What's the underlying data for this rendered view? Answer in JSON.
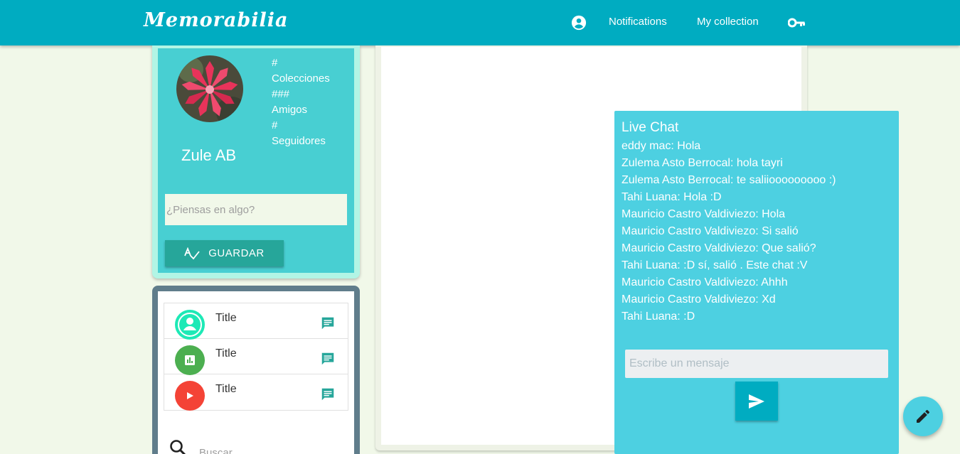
{
  "nav": {
    "brand": "Memorabilia",
    "links": {
      "notifications": "Notifications",
      "collection": "My collection"
    },
    "icons": {
      "account": "account-circle-icon",
      "key": "vpn-key-icon"
    }
  },
  "profile": {
    "name": "Zule AB",
    "stats": {
      "collections_count": "#",
      "collections_label": "Colecciones",
      "friends_count": "###",
      "friends_label": "Amigos",
      "followers_count": "#",
      "followers_label": "Seguidores"
    },
    "thought_placeholder": "¿Piensas en algo?",
    "save_label": "GUARDAR"
  },
  "list": {
    "items": [
      {
        "title": "Title",
        "icon": "account-icon",
        "color": "#1de9b6"
      },
      {
        "title": "Title",
        "icon": "chart-icon",
        "color": "#4caf50"
      },
      {
        "title": "Title",
        "icon": "play-icon",
        "color": "#f44336"
      }
    ],
    "search_placeholder": "Buscar"
  },
  "chat": {
    "title": "Live Chat",
    "messages": [
      "eddy mac: Hola",
      "Zulema Asto Berrocal: hola tayri",
      "Zulema Asto Berrocal: te saliiooooooooo :)",
      "Tahi Luana: Hola :D",
      "Mauricio Castro Valdiviezo: Hola",
      "Mauricio Castro Valdiviezo: Si salió",
      "Mauricio Castro Valdiviezo: Que salió?",
      "Tahi Luana: :D sí, salió . Este chat :V",
      "Mauricio Castro Valdiviezo: Ahhh",
      "Mauricio Castro Valdiviezo: Xd",
      "Tahi Luana: :D"
    ],
    "input_placeholder": "Escribe un mensaje"
  },
  "colors": {
    "primary": "#00acc1",
    "profile_bg": "#48cfd2",
    "chat_bg": "#4dd0e1",
    "teal_button": "#26a69a",
    "page_bg": "#f1f8e9"
  }
}
